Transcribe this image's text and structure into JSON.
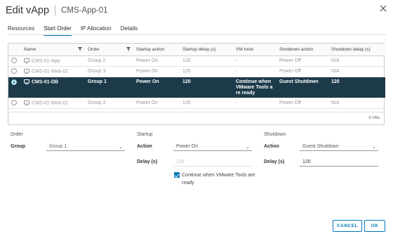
{
  "header": {
    "title": "Edit vApp",
    "subtitle": "CMS-App-01"
  },
  "tabs": [
    {
      "label": "Resources",
      "active": false
    },
    {
      "label": "Start Order",
      "active": true
    },
    {
      "label": "IP Allocation",
      "active": false
    },
    {
      "label": "Details",
      "active": false
    }
  ],
  "grid": {
    "columns": [
      "Name",
      "Order",
      "Startup action",
      "Startup delay (s)",
      "VM tools",
      "Shutdown action",
      "Shutdown delay (s)"
    ],
    "rows": [
      {
        "name": "CMS-01-App",
        "order": "Group 2",
        "startup_action": "Power On",
        "startup_delay": "120",
        "vm_tools": "-",
        "shutdown_action": "Power Off",
        "shutdown_delay": "N/A",
        "selected": false
      },
      {
        "name": "CMS-01-Web-02",
        "order": "Group 3",
        "startup_action": "Power On",
        "startup_delay": "120",
        "vm_tools": "-",
        "shutdown_action": "Power Off",
        "shutdown_delay": "N/A",
        "selected": false
      },
      {
        "name": "CMS-01-DB",
        "order": "Group 1",
        "startup_action": "Power On",
        "startup_delay": "120",
        "vm_tools": "Continue when VMware Tools a re ready",
        "shutdown_action": "Guest Shutdown",
        "shutdown_delay": "120",
        "selected": true
      },
      {
        "name": "CMS-01-Web-01",
        "order": "Group 3",
        "startup_action": "Power On",
        "startup_delay": "120",
        "vm_tools": "-",
        "shutdown_action": "Power Off",
        "shutdown_delay": "N/A",
        "selected": false
      }
    ],
    "footer": "4 VMs"
  },
  "order": {
    "title": "Order",
    "group_label": "Group",
    "group_value": "Group 1"
  },
  "startup": {
    "title": "Startup",
    "action_label": "Action",
    "action_value": "Power On",
    "delay_label": "Delay (s)",
    "delay_value": "120",
    "checkbox_label": "Continue when VMware Tools are ready"
  },
  "shutdown": {
    "title": "Shutdown",
    "action_label": "Action",
    "action_value": "Guest Shutdown",
    "delay_label": "Delay (s)",
    "delay_value": "120"
  },
  "buttons": {
    "cancel": "CANCEL",
    "ok": "OK"
  }
}
